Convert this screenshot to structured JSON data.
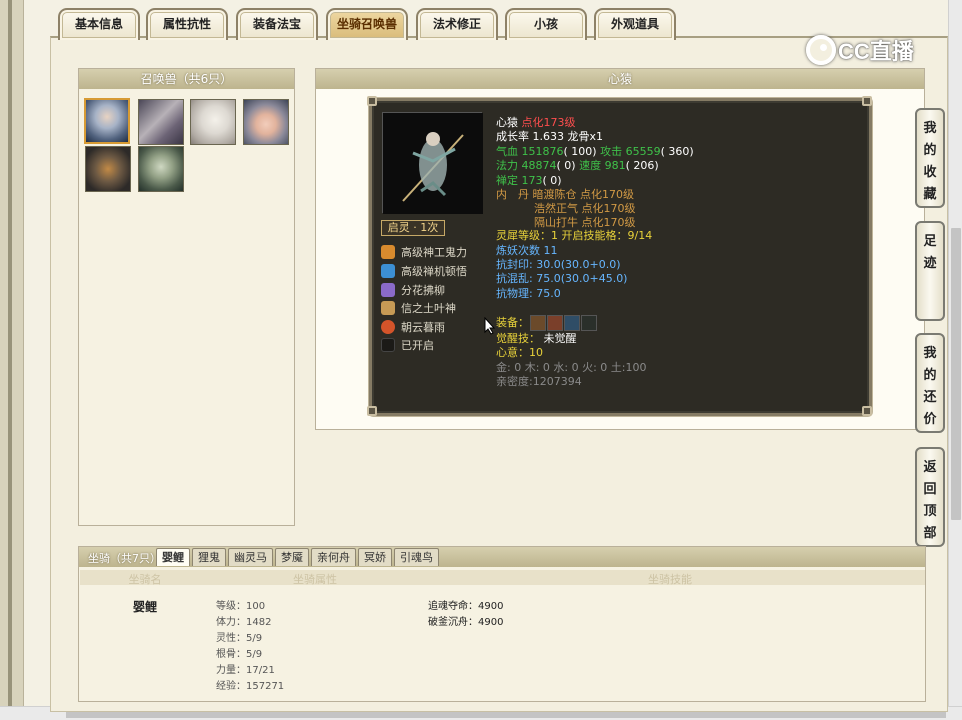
{
  "tabs": [
    "基本信息",
    "属性抗性",
    "装备法宝",
    "坐骑召唤兽",
    "法术修正",
    "小孩",
    "外观道具"
  ],
  "active_tab": 3,
  "logo_text": "CC直播",
  "pet_list": {
    "header": "召唤兽（共6只）",
    "pets": [
      "pet-1",
      "pet-2",
      "pet-3",
      "pet-4",
      "pet-5",
      "pet-6"
    ]
  },
  "detail": {
    "header": "心猿",
    "awaken": "启灵 · 1次",
    "skills": [
      "高级神工鬼力",
      "高级禅机顿悟",
      "分花拂柳",
      "信之土叶神",
      "朝云暮雨",
      "已开启"
    ],
    "name": "心猿",
    "level": "点化173级",
    "growth": "成长率 1.633 龙骨x1",
    "hp_label": "气血",
    "hp": "151876",
    "hp_extra": "( 100)",
    "atk_label": "攻击",
    "atk": "65559",
    "atk_extra": "( 360)",
    "mp_label": "法力",
    "mp": "48874",
    "mp_extra": "( 0)",
    "spd_label": "速度",
    "spd": "981",
    "spd_extra": "( 206)",
    "zen_label": "禅定",
    "zen": "173",
    "zen_extra": "( 0)",
    "dan_label": "内　丹",
    "dan": [
      "暗渡陈仓 点化170级",
      "浩然正气 点化170级",
      "隔山打牛 点化170级"
    ],
    "spirit": "灵犀等级：1 开启技能格：9/14",
    "refine": "炼妖次数 11",
    "res": [
      "抗封印: 30.0(30.0+0.0)",
      "抗混乱: 75.0(30.0+45.0)",
      "抗物理: 75.0"
    ],
    "equip_label": "装备：",
    "juexing_label": "觉醒技：",
    "juexing": "未觉醒",
    "xinyi": "心意：10",
    "elements": "金: 0 木: 0 水: 0 火: 0 土:100",
    "intimacy": "亲密度:1207394"
  },
  "side_buttons": [
    "我的收藏",
    "足迹",
    "我的还价",
    "返回顶部"
  ],
  "mount": {
    "label": "坐骑（共7只）",
    "tabs": [
      "婴鲤",
      "狸鬼",
      "幽灵马",
      "梦魇",
      "亲何舟",
      "冥娇",
      "引魂鸟"
    ],
    "cols": [
      "坐骑名",
      "坐骑属性",
      "坐骑技能"
    ],
    "name": "婴鲤",
    "attrs": [
      "等级：100",
      "体力：1482",
      "灵性：5/9",
      "根骨：5/9",
      "力量：17/21",
      "经验：157271"
    ],
    "skills": [
      "追魂夺命：4900",
      "破釜沉舟：4900"
    ]
  }
}
